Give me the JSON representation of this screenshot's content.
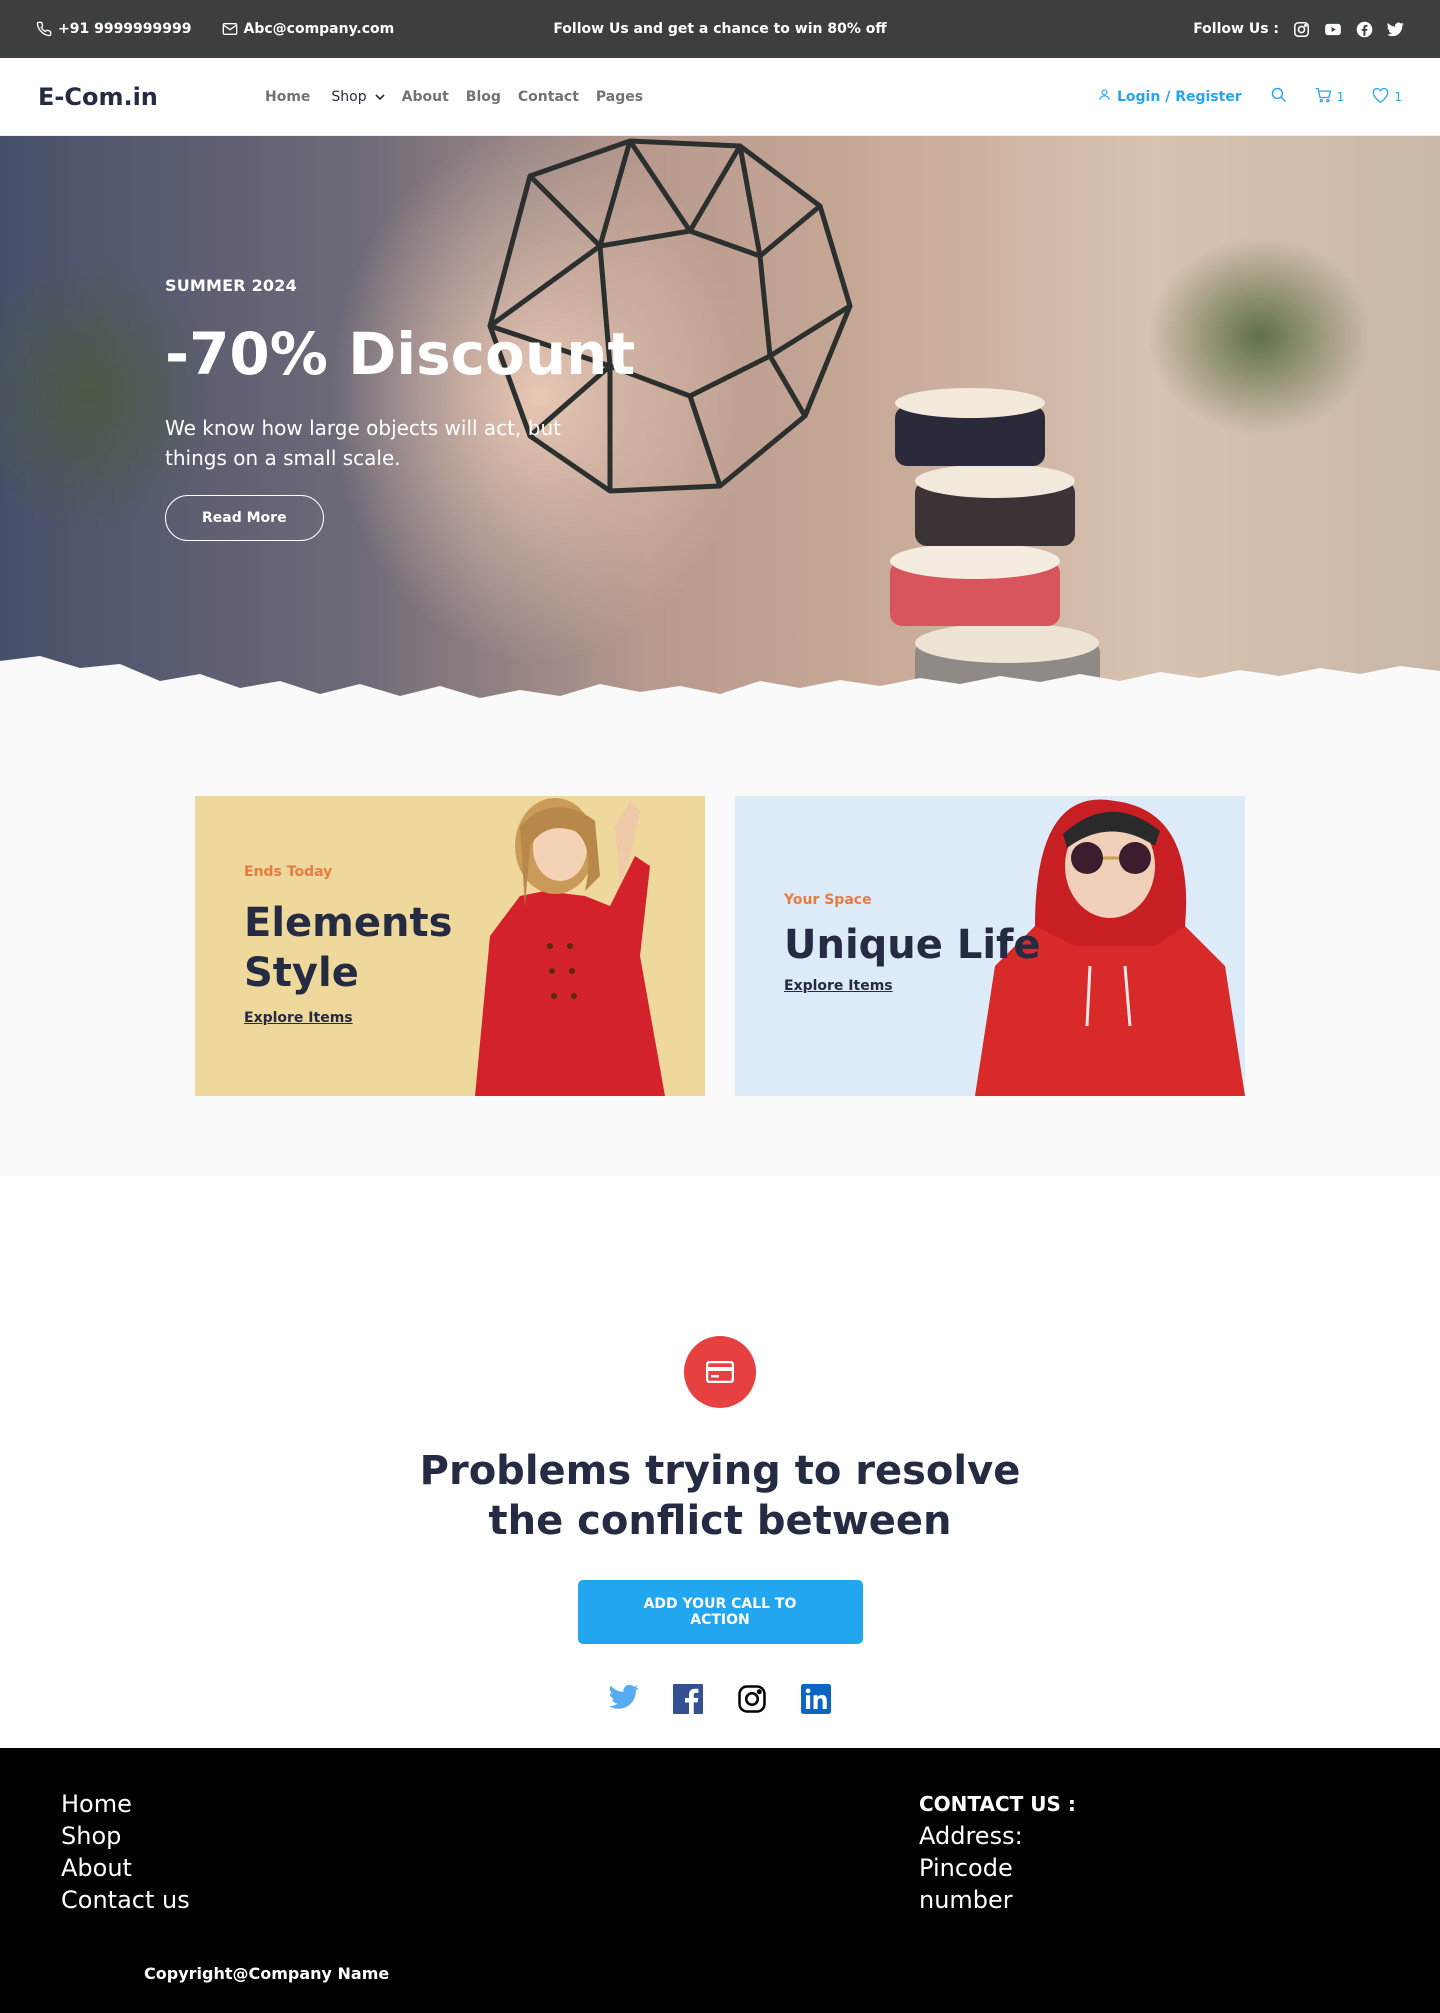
{
  "topbar": {
    "phone": "+91 9999999999",
    "email": "Abc@company.com",
    "promo": "Follow Us  and get a chance to win 80% off",
    "follow_label": "Follow Us  :",
    "social_icons": [
      "instagram-icon",
      "youtube-icon",
      "facebook-icon",
      "twitter-icon"
    ]
  },
  "navbar": {
    "logo": "E-Com.in",
    "links": [
      "Home",
      "Shop",
      "About",
      "Blog",
      "Contact",
      "Pages"
    ],
    "login": "Login / Register",
    "cart_count": "1",
    "wishlist_count": "1"
  },
  "hero": {
    "eyebrow": "SUMMER 2024",
    "title": "-70% Discount",
    "description": "We know how large objects will act, but things on a small scale.",
    "button": "Read More"
  },
  "cards": [
    {
      "tag": "Ends Today",
      "title_line1": "Elements",
      "title_line2": "Style",
      "link": "Explore Items"
    },
    {
      "tag": "Your Space",
      "title_line1": "Unique Life",
      "link": "Explore Items"
    }
  ],
  "cta": {
    "icon": "credit-card-icon",
    "title_line1": "Problems trying to resolve",
    "title_line2": "the conflict between",
    "button": "ADD YOUR CALL TO ACTION",
    "social_icons": [
      "twitter-icon",
      "facebook-icon",
      "instagram-icon",
      "linkedin-icon"
    ]
  },
  "footer": {
    "links": [
      "Home",
      "Shop",
      "About",
      "Contact us"
    ],
    "contact_heading": "CONTACT US :",
    "contact_lines": [
      "Address:",
      "Pincode",
      "number"
    ],
    "copyright": "Copyright@Company Name"
  },
  "colors": {
    "topbar_bg": "#3C403D",
    "primary_blue": "#23A6F0",
    "accent_red": "#E74040",
    "accent_orange": "#E77C40",
    "dark_text": "#252B42",
    "card_yellow": "#EED89C",
    "card_blue": "#DDEAF7",
    "footer_bg": "#000000"
  }
}
